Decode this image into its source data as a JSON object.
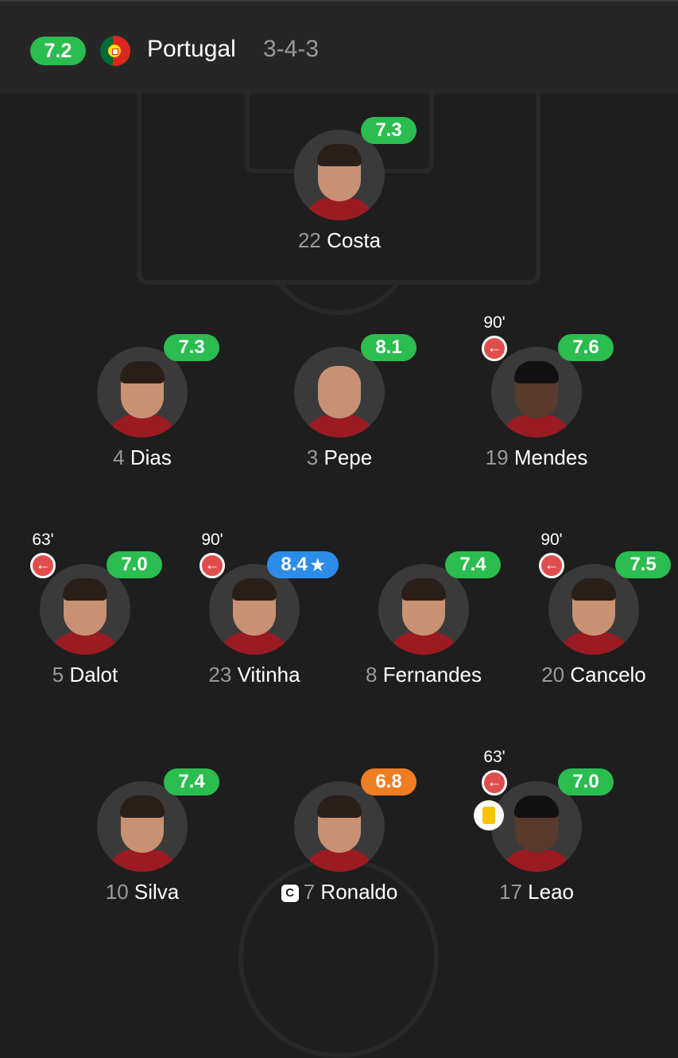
{
  "header": {
    "team_rating": "7.2",
    "team_name": "Portugal",
    "formation": "3-4-3",
    "flag_icon": "portugal-flag-icon"
  },
  "colors": {
    "rating_green": "#2bbd4f",
    "rating_blue": "#2d8ce8",
    "rating_orange": "#ef7d22",
    "sub_red": "#e04d4d",
    "yellow_card": "#f5c400",
    "background": "#1e1e1e"
  },
  "players": [
    {
      "number": "22",
      "name": "Costa",
      "rating": "7.3",
      "rating_color": "green",
      "sub_minute": "",
      "captain": false,
      "yellow_card": false
    },
    {
      "number": "4",
      "name": "Dias",
      "rating": "7.3",
      "rating_color": "green",
      "sub_minute": "",
      "captain": false,
      "yellow_card": false
    },
    {
      "number": "3",
      "name": "Pepe",
      "rating": "8.1",
      "rating_color": "green",
      "sub_minute": "",
      "captain": false,
      "yellow_card": false
    },
    {
      "number": "19",
      "name": "Mendes",
      "rating": "7.6",
      "rating_color": "green",
      "sub_minute": "90'",
      "captain": false,
      "yellow_card": false
    },
    {
      "number": "5",
      "name": "Dalot",
      "rating": "7.0",
      "rating_color": "green",
      "sub_minute": "63'",
      "captain": false,
      "yellow_card": false
    },
    {
      "number": "23",
      "name": "Vitinha",
      "rating": "8.4",
      "rating_color": "blue",
      "star_icon": "star-icon",
      "sub_minute": "90'",
      "captain": false,
      "yellow_card": false
    },
    {
      "number": "8",
      "name": "Fernandes",
      "rating": "7.4",
      "rating_color": "green",
      "sub_minute": "",
      "captain": false,
      "yellow_card": false
    },
    {
      "number": "20",
      "name": "Cancelo",
      "rating": "7.5",
      "rating_color": "green",
      "sub_minute": "90'",
      "captain": false,
      "yellow_card": false
    },
    {
      "number": "10",
      "name": "Silva",
      "rating": "7.4",
      "rating_color": "green",
      "sub_minute": "",
      "captain": false,
      "yellow_card": false
    },
    {
      "number": "7",
      "name": "Ronaldo",
      "rating": "6.8",
      "rating_color": "orange",
      "sub_minute": "",
      "captain": true,
      "captain_badge": "C",
      "yellow_card": false
    },
    {
      "number": "17",
      "name": "Leao",
      "rating": "7.0",
      "rating_color": "green",
      "sub_minute": "63'",
      "captain": false,
      "yellow_card": true
    }
  ]
}
